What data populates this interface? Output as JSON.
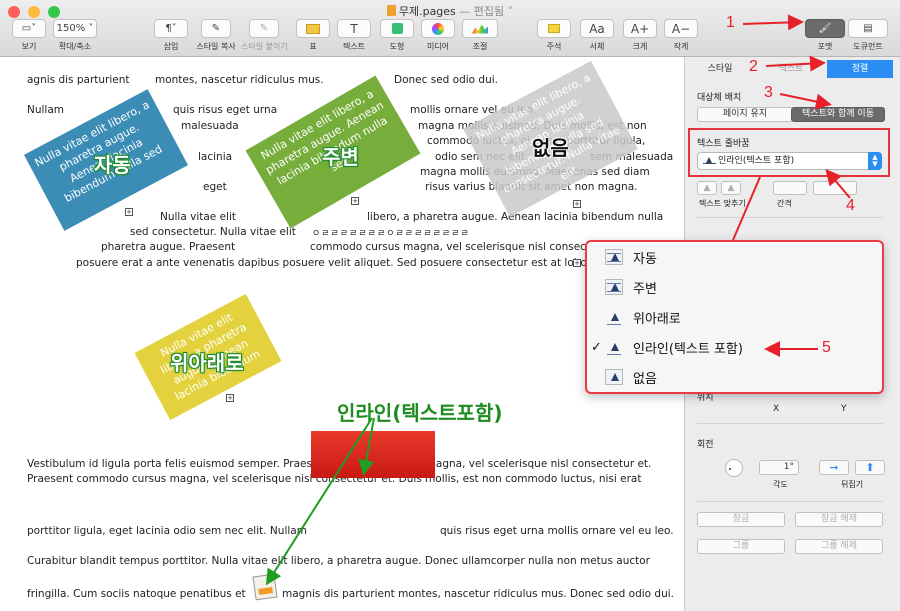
{
  "window": {
    "title": "무제.pages",
    "subtitle": "— 편집됨 ˅"
  },
  "toolbar": {
    "view": {
      "label": "보기"
    },
    "zoom": {
      "value": "150% ˅",
      "label": "확대/축소"
    },
    "insert": {
      "label": "삽입"
    },
    "copy_style": {
      "label": "스타일 복사"
    },
    "paste_style": {
      "label": "스타일 붙이기"
    },
    "table": {
      "label": "표"
    },
    "text": {
      "label": "텍스트"
    },
    "shape": {
      "label": "도형"
    },
    "media": {
      "label": "미디어"
    },
    "adjust": {
      "label": "조절"
    },
    "comment": {
      "label": "주석"
    },
    "font": {
      "label": "서체",
      "glyph": "Aa"
    },
    "bigger": {
      "label": "크게",
      "glyph": "A+"
    },
    "smaller": {
      "label": "작게",
      "glyph": "A−"
    },
    "format": {
      "label": "포맷"
    },
    "document": {
      "label": "도큐먼트"
    }
  },
  "document": {
    "lines": [
      "agnis dis parturient",
      "montes, nascetur ridiculus mus.",
      "Donec sed odio dui.",
      "Nullam",
      "quis risus eget urna",
      "malesuada",
      "mollis ornare vel eu leo.",
      "magna mollis euismod. Duis mollis, est non",
      "commodo luctus, nisi erat porttitor ligula,",
      "odio sem nec elit.",
      "sem malesuada",
      "lacinia",
      "magna mollis euismod. Maecenas sed diam",
      "eget",
      "risus varius blandit sit amet non magna.",
      "Nulla vitae elit",
      "libero, a pharetra augue. Aenean lacinia bibendum nulla",
      "sed consectetur. Nulla vitae elit",
      "ㅇㄹㄹㄹㄹㄹㄹㄹㅇㄹㄹㄹㄹㄹㄹㄹㄹ",
      "pharetra augue. Praesent",
      "commodo cursus magna, vel scelerisque nisl consectetur et.",
      "posuere erat a ante venenatis dapibus posuere velit aliquet. Sed posuere consectetur est at lobortis.",
      "Vestibulum id ligula porta felis euismod semper. Praesent commodo cursus magna, vel scelerisque nisl consectetur et.",
      "Praesent commodo cursus magna, vel scelerisque nisl consectetur et. Duis mollis, est non commodo luctus, nisi erat",
      "porttitor ligula, eget lacinia odio sem nec elit. Nullam",
      "quis risus eget urna mollis ornare vel eu leo.",
      "Curabitur blandit tempus porttitor. Nulla vitae elit libero, a pharetra augue. Donec ullamcorper nulla non metus auctor",
      "fringilla. Cum sociis natoque penatibus et",
      "magnis dis parturient montes, nascetur ridiculus mus. Donec sed odio dui."
    ],
    "shapes": {
      "blue": {
        "text": "Nulla vitae elit libero, a pharetra augue. Aenean lacinia bibendum nulla sed",
        "label": "자동"
      },
      "green": {
        "text": "Nulla vitae elit libero, a pharetra augue. Aenean lacinia bibendum nulla sed",
        "label": "주변"
      },
      "grey": {
        "text": "Nulla vitae elit libero, a pharetra augue. Aenean lacinia bibendum nulla sed consectetur. Nulla vitae elit",
        "label": "없음"
      },
      "yellow": {
        "text": "Nulla vitae elit libero, a pharetra augue. Aenean lacinia bibendum",
        "label": "위아래로"
      }
    },
    "inline_label": "인라인(텍스트포함)"
  },
  "panel": {
    "tabs": [
      "스타일",
      "텍스트",
      "정렬"
    ],
    "object_placement": {
      "label": "대상체 배치",
      "options": [
        "페이지 유지",
        "텍스트와 함께 이동"
      ],
      "selected": "텍스트와 함께 이동"
    },
    "text_wrap": {
      "label": "텍스트 줄바꿈",
      "value": "인라인(텍스트 포함)"
    },
    "text_fit_label": "텍스트 맞추기",
    "spacing_label": "간격",
    "position_label": "위치",
    "x_label": "X",
    "y_label": "Y",
    "rotate_label": "회전",
    "angle_value": "1°",
    "angle_label": "각도",
    "flip_label": "뒤집기",
    "lock": "잠금",
    "unlock": "잠금 해제",
    "group": "그룹",
    "ungroup": "그룹 해제"
  },
  "popup": {
    "items": [
      "자동",
      "주변",
      "위아래로",
      "인라인(텍스트 포함)",
      "없음"
    ],
    "checked": "인라인(텍스트 포함)"
  },
  "annotations": [
    "1",
    "2",
    "3",
    "4",
    "5"
  ],
  "colors": {
    "accent": "#2b8cf4",
    "annotation": "#e8202a",
    "label_green": "#1e8c1e"
  }
}
